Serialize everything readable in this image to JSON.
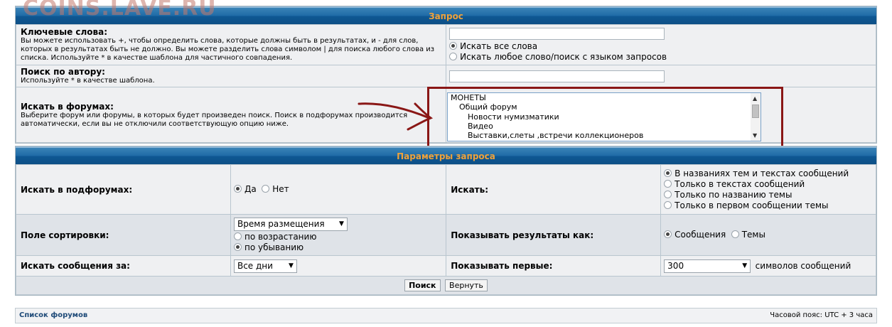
{
  "watermark": "COINS.LAVE.RU",
  "query": {
    "title": "Запрос",
    "keywords": {
      "label": "Ключевые слова:",
      "desc": "Вы можете использовать +, чтобы определить слова, которые должны быть в результатах, и - для слов, которых в результатах быть не должно. Вы можете разделить слова символом | для поиска любого слова из списка. Используйте * в качестве шаблона для частичного совпадения.",
      "value": "",
      "options": [
        "Искать все слова",
        "Искать любое слово/поиск с языком запросов"
      ]
    },
    "author": {
      "label": "Поиск по автору:",
      "desc": "Используйте * в качестве шаблона.",
      "value": ""
    },
    "forums": {
      "label": "Искать в форумах:",
      "desc": "Выберите форум или форумы, в которых будет произведен поиск. Поиск в подфорумах производится автоматически, если вы не отключили соответствующую опцию ниже.",
      "items": [
        "МОНЕТЫ",
        "Общий форум",
        "Новости нумизматики",
        "Видео",
        "Выставки,слеты ,встречи коллекционеров"
      ]
    }
  },
  "params": {
    "title": "Параметры запроса",
    "subforums": {
      "label": "Искать в подфорумах:",
      "yes": "Да",
      "no": "Нет"
    },
    "search_in": {
      "label": "Искать:",
      "options": [
        "В названиях тем и текстах сообщений",
        "Только в текстах сообщений",
        "Только по названию темы",
        "Только в первом сообщении темы"
      ]
    },
    "sort": {
      "label": "Поле сортировки:",
      "value": "Время размещения",
      "asc": "по возрастанию",
      "desc": "по убыванию"
    },
    "show_as": {
      "label": "Показывать результаты как:",
      "posts": "Сообщения",
      "topics": "Темы"
    },
    "period": {
      "label": "Искать сообщения за:",
      "value": "Все дни"
    },
    "show_first": {
      "label": "Показывать первые:",
      "value": "300",
      "suffix": "символов сообщений"
    },
    "search_btn": "Поиск",
    "reset_btn": "Вернуть"
  },
  "footer": {
    "link": "Список форумов",
    "timezone": "Часовой пояс: UTC + 3 часа"
  },
  "colors": {
    "bar_text": "#f0a23a",
    "bar_bg": "#1e6aa6",
    "highlight": "#8a1716",
    "arrow": "#8a1716"
  }
}
